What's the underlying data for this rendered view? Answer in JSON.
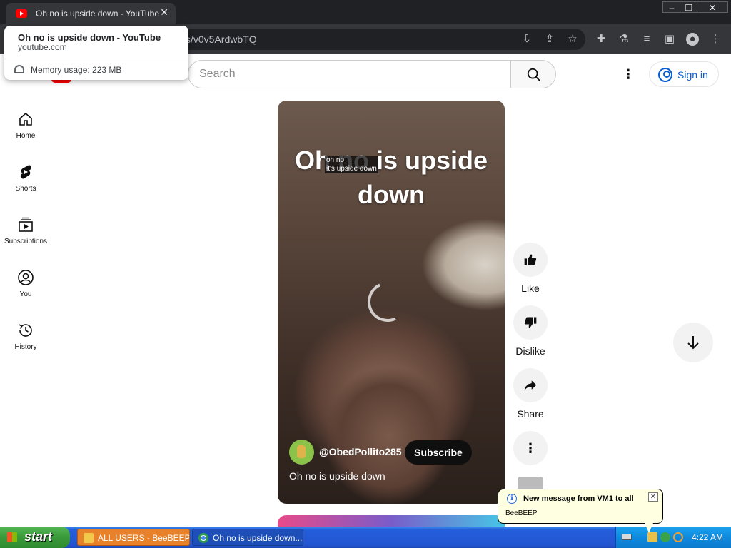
{
  "browser": {
    "tab_title": "Oh no is upside down - YouTube",
    "tab_close": "✕",
    "url_visible": "s/v0v5ArdwbTQ",
    "window_controls": [
      "minimize",
      "restore",
      "close"
    ]
  },
  "hovercard": {
    "title": "Oh no is upside down - YouTube",
    "domain": "youtube.com",
    "memory": "Memory usage: 223 MB"
  },
  "youtube": {
    "search_placeholder": "Search",
    "signin_label": "Sign in",
    "nav": [
      {
        "label": "Home",
        "icon": "home-icon"
      },
      {
        "label": "Shorts",
        "icon": "shorts-icon"
      },
      {
        "label": "Subscriptions",
        "icon": "subscriptions-icon"
      },
      {
        "label": "You",
        "icon": "you-icon"
      },
      {
        "label": "History",
        "icon": "history-icon"
      }
    ],
    "short": {
      "overlay_title": "Oh no is upside down",
      "caption_text": "oh no\nit's upside down",
      "channel": "@ObedPollito285",
      "subscribe": "Subscribe",
      "title": "Oh no is upside down"
    },
    "actions": {
      "like": "Like",
      "dislike": "Dislike",
      "share": "Share"
    }
  },
  "notification": {
    "title": "New message from VM1 to all",
    "body": "BeeBEEP"
  },
  "taskbar": {
    "start": "start",
    "tasks": [
      {
        "label": "ALL USERS - BeeBEEP...",
        "active": false
      },
      {
        "label": "Oh no is upside down...",
        "active": true
      }
    ],
    "clock": "4:22 AM"
  },
  "colors": {
    "youtube_red": "#ff0000",
    "signin_blue": "#065fd4",
    "taskbar_blue": "#245edb",
    "start_green": "#3a9a3a",
    "balloon_bg": "#ffffe1"
  }
}
